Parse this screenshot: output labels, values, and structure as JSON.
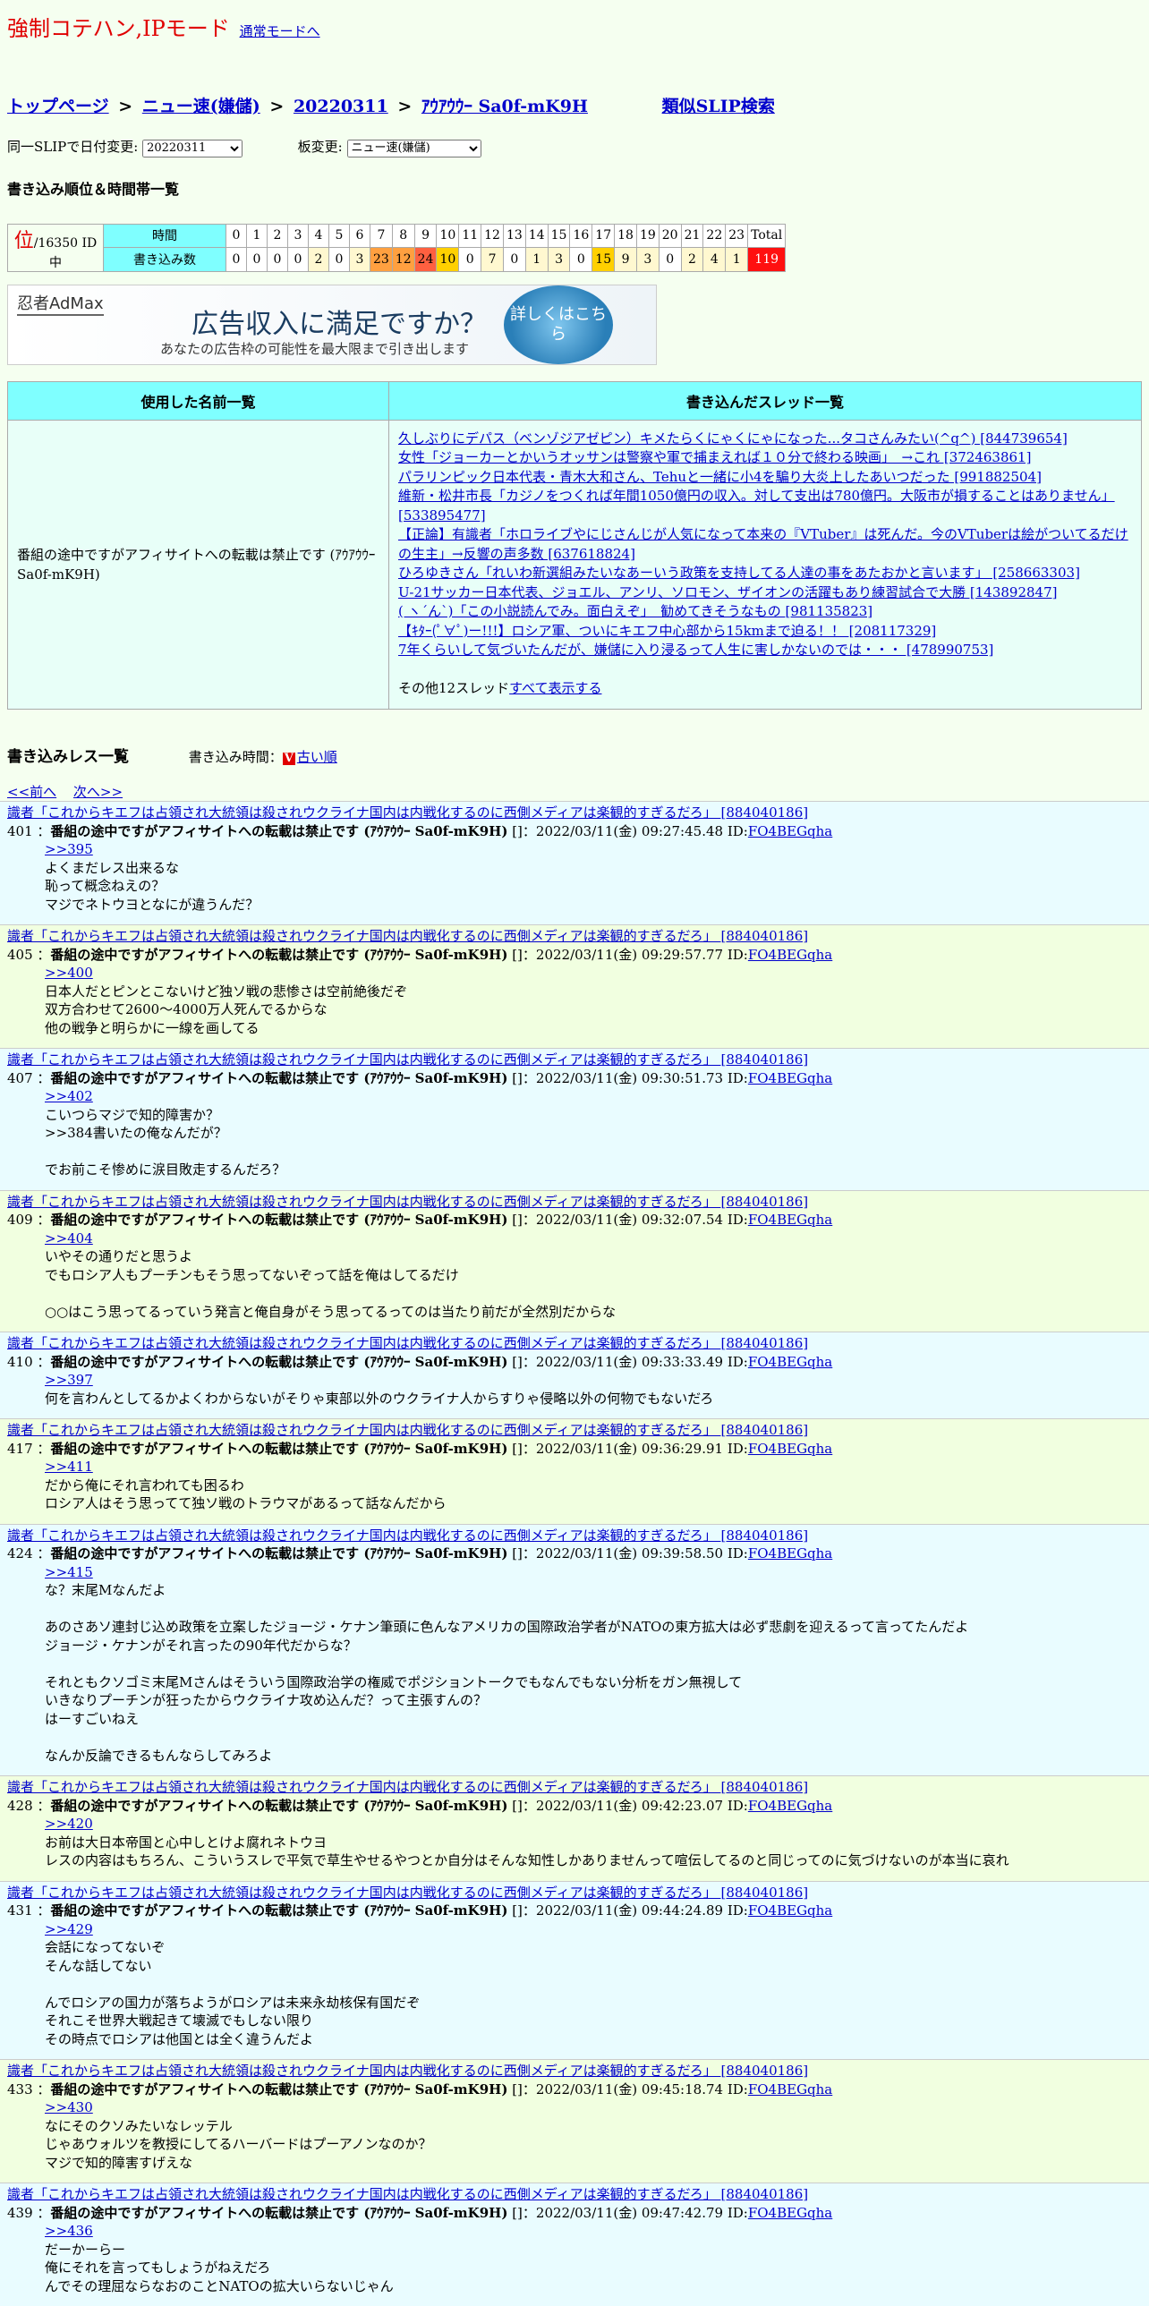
{
  "header": {
    "title": "強制コテハン,IPモード",
    "normal_mode_link": "通常モードへ"
  },
  "breadcrumb": {
    "top": "トップページ",
    "sep": ">",
    "board": "ニュー速(嫌儲)",
    "date": "20220311",
    "slip": "ｱｳｱｳｳｰ Sa0f-mK9H",
    "similar": "類似SLIP検索"
  },
  "selectors": {
    "date_label": "同一SLIPで日付変更:",
    "date_value": "20220311",
    "board_label": "板変更:",
    "board_value": "ニュー速(嫌儲)"
  },
  "ranking": {
    "heading": "書き込み順位＆時間帯一覧",
    "rank_kanji": "位",
    "rank_total": "/16350 ID中",
    "row1_label": "時間",
    "row2_label": "書き込み数",
    "hours": [
      "0",
      "1",
      "2",
      "3",
      "4",
      "5",
      "6",
      "7",
      "8",
      "9",
      "10",
      "11",
      "12",
      "13",
      "14",
      "15",
      "16",
      "17",
      "18",
      "19",
      "20",
      "21",
      "22",
      "23",
      "Total"
    ],
    "counts": [
      "0",
      "0",
      "0",
      "0",
      "2",
      "0",
      "3",
      "23",
      "12",
      "24",
      "10",
      "0",
      "7",
      "0",
      "1",
      "3",
      "0",
      "15",
      "9",
      "3",
      "0",
      "2",
      "4",
      "1",
      "119"
    ]
  },
  "ad": {
    "logo": "忍者AdMax",
    "headline": "広告収入に満足ですか？",
    "sub": "あなたの広告枠の可能性を最大限まで引き出します",
    "button": "詳しくはこちら"
  },
  "names_table": {
    "col1_header": "使用した名前一覧",
    "col2_header": "書き込んだスレッド一覧",
    "name": "番組の途中ですがアフィサイトへの転載は禁止です (ｱｳｱｳｳｰ Sa0f-mK9H)",
    "threads": [
      "久しぶりにデパス（ベンゾジアゼピン）キメたらくにゃくにゃになった...タコさんみたい(^q^) [844739654]",
      "女性「ジョーカーとかいうオッサンは警察や軍で捕まえれば１０分で終わる映画」　→これ [372463861]",
      "パラリンピック日本代表・青木大和さん、Tehuと一緒に小4を騙り大炎上したあいつだった [991882504]",
      "維新・松井市長「カジノをつくれば年間1050億円の収入。対して支出は780億円。大阪市が損することはありません」 [533895477]",
      "【正論】有識者「ホロライブやにじさんじが人気になって本来の『VTuber』は死んだ。今のVTuberは絵がついてるだけの生主」→反響の声多数 [637618824]",
      "ひろゆきさん「れいわ新選組みたいなあーいう政策を支持してる人達の事をあたおかと言います」 [258663303]",
      "U-21サッカー日本代表、ジョエル、アンリ、ソロモン、ザイオンの活躍もあり練習試合で大勝 [143892847]",
      "( ヽ´ん`)「この小説読んでみ。面白えぞ」　勧めてきそうなもの [981135823]",
      "【ｷﾀｰ(ﾟ∀ﾟ)ー!!!】ロシア軍、ついにキエフ中心部から15kmまで迫る！！ [208117329]",
      "7年くらいして気づいたんだが、嫌儲に入り浸るって人生に害しかないのでは・・・ [478990753]"
    ],
    "other_prefix": "その他12スレッド",
    "other_link": "すべて表示する"
  },
  "post_list": {
    "heading": "書き込みレス一覧",
    "time_label": "書き込み時間：",
    "order_icon": "V",
    "order_link": "古い順",
    "prev": "<<前へ",
    "next": "次へ>>"
  },
  "posts": [
    {
      "thread": "識者「これからキエフは占領され大統領は殺されウクライナ国内は内戦化するのに西側メディアは楽観的すぎるだろ」 [884040186]",
      "num": "401",
      "name": "番組の途中ですがアフィサイトへの転載は禁止です (ｱｳｱｳｳｰ Sa0f-mK9H)",
      "date": "[]：2022/03/11(金) 09:27:45.48 ID:",
      "id": "FO4BEGqha",
      "lines": [
        ">>395",
        "よくまだレス出来るな",
        "恥って概念ねえの？",
        "マジでネトウヨとなにが違うんだ？"
      ]
    },
    {
      "thread": "識者「これからキエフは占領され大統領は殺されウクライナ国内は内戦化するのに西側メディアは楽観的すぎるだろ」 [884040186]",
      "num": "405",
      "name": "番組の途中ですがアフィサイトへの転載は禁止です (ｱｳｱｳｳｰ Sa0f-mK9H)",
      "date": "[]：2022/03/11(金) 09:29:57.77 ID:",
      "id": "FO4BEGqha",
      "lines": [
        ">>400",
        "日本人だとピンとこないけど独ソ戦の悲惨さは空前絶後だぞ",
        "双方合わせて2600～4000万人死んでるからな",
        "他の戦争と明らかに一線を画してる"
      ]
    },
    {
      "thread": "識者「これからキエフは占領され大統領は殺されウクライナ国内は内戦化するのに西側メディアは楽観的すぎるだろ」 [884040186]",
      "num": "407",
      "name": "番組の途中ですがアフィサイトへの転載は禁止です (ｱｳｱｳｳｰ Sa0f-mK9H)",
      "date": "[]：2022/03/11(金) 09:30:51.73 ID:",
      "id": "FO4BEGqha",
      "lines": [
        ">>402",
        "こいつらマジで知的障害か？",
        ">>384書いたの俺なんだが？",
        "",
        "でお前こそ惨めに涙目敗走するんだろ？"
      ]
    },
    {
      "thread": "識者「これからキエフは占領され大統領は殺されウクライナ国内は内戦化するのに西側メディアは楽観的すぎるだろ」 [884040186]",
      "num": "409",
      "name": "番組の途中ですがアフィサイトへの転載は禁止です (ｱｳｱｳｳｰ Sa0f-mK9H)",
      "date": "[]：2022/03/11(金) 09:32:07.54 ID:",
      "id": "FO4BEGqha",
      "lines": [
        ">>404",
        "いやその通りだと思うよ",
        "でもロシア人もプーチンもそう思ってないぞって話を俺はしてるだけ",
        "",
        "○○はこう思ってるっていう発言と俺自身がそう思ってるってのは当たり前だが全然別だからな"
      ]
    },
    {
      "thread": "識者「これからキエフは占領され大統領は殺されウクライナ国内は内戦化するのに西側メディアは楽観的すぎるだろ」 [884040186]",
      "num": "410",
      "name": "番組の途中ですがアフィサイトへの転載は禁止です (ｱｳｱｳｳｰ Sa0f-mK9H)",
      "date": "[]：2022/03/11(金) 09:33:33.49 ID:",
      "id": "FO4BEGqha",
      "lines": [
        ">>397",
        "何を言わんとしてるかよくわからないがそりゃ東部以外のウクライナ人からすりゃ侵略以外の何物でもないだろ"
      ]
    },
    {
      "thread": "識者「これからキエフは占領され大統領は殺されウクライナ国内は内戦化するのに西側メディアは楽観的すぎるだろ」 [884040186]",
      "num": "417",
      "name": "番組の途中ですがアフィサイトへの転載は禁止です (ｱｳｱｳｳｰ Sa0f-mK9H)",
      "date": "[]：2022/03/11(金) 09:36:29.91 ID:",
      "id": "FO4BEGqha",
      "lines": [
        ">>411",
        "だから俺にそれ言われても困るわ",
        "ロシア人はそう思ってて独ソ戦のトラウマがあるって話なんだから"
      ]
    },
    {
      "thread": "識者「これからキエフは占領され大統領は殺されウクライナ国内は内戦化するのに西側メディアは楽観的すぎるだろ」 [884040186]",
      "num": "424",
      "name": "番組の途中ですがアフィサイトへの転載は禁止です (ｱｳｱｳｳｰ Sa0f-mK9H)",
      "date": "[]：2022/03/11(金) 09:39:58.50 ID:",
      "id": "FO4BEGqha",
      "lines": [
        ">>415",
        "な？末尾Mなんだよ",
        "",
        "あのさあソ連封じ込め政策を立案したジョージ・ケナン筆頭に色んなアメリカの国際政治学者がNATOの東方拡大は必ず悲劇を迎えるって言ってたんだよ",
        "ジョージ・ケナンがそれ言ったの90年代だからな？",
        "",
        "それともクソゴミ末尾Mさんはそういう国際政治学の権威でポジショントークでもなんでもない分析をガン無視して",
        "いきなりプーチンが狂ったからウクライナ攻め込んだ？って主張すんの？",
        "はーすごいねえ",
        "",
        "なんか反論できるもんならしてみろよ"
      ]
    },
    {
      "thread": "識者「これからキエフは占領され大統領は殺されウクライナ国内は内戦化するのに西側メディアは楽観的すぎるだろ」 [884040186]",
      "num": "428",
      "name": "番組の途中ですがアフィサイトへの転載は禁止です (ｱｳｱｳｳｰ Sa0f-mK9H)",
      "date": "[]：2022/03/11(金) 09:42:23.07 ID:",
      "id": "FO4BEGqha",
      "lines": [
        ">>420",
        "お前は大日本帝国と心中しとけよ腐れネトウヨ",
        "レスの内容はもちろん、こういうスレで平気で草生やせるやつとか自分はそんな知性しかありませんって喧伝してるのと同じってのに気づけないのが本当に哀れ"
      ]
    },
    {
      "thread": "識者「これからキエフは占領され大統領は殺されウクライナ国内は内戦化するのに西側メディアは楽観的すぎるだろ」 [884040186]",
      "num": "431",
      "name": "番組の途中ですがアフィサイトへの転載は禁止です (ｱｳｱｳｳｰ Sa0f-mK9H)",
      "date": "[]：2022/03/11(金) 09:44:24.89 ID:",
      "id": "FO4BEGqha",
      "lines": [
        ">>429",
        "会話になってないぞ",
        "そんな話してない",
        "",
        "んでロシアの国力が落ちようがロシアは未来永劫核保有国だぞ",
        "それこそ世界大戦起きて壊滅でもしない限り",
        "その時点でロシアは他国とは全く違うんだよ"
      ]
    },
    {
      "thread": "識者「これからキエフは占領され大統領は殺されウクライナ国内は内戦化するのに西側メディアは楽観的すぎるだろ」 [884040186]",
      "num": "433",
      "name": "番組の途中ですがアフィサイトへの転載は禁止です (ｱｳｱｳｳｰ Sa0f-mK9H)",
      "date": "[]：2022/03/11(金) 09:45:18.74 ID:",
      "id": "FO4BEGqha",
      "lines": [
        ">>430",
        "なにそのクソみたいなレッテル",
        "じゃあウォルツを教授にしてるハーバードはプーアノンなのか？",
        "マジで知的障害すげえな"
      ]
    },
    {
      "thread": "識者「これからキエフは占領され大統領は殺されウクライナ国内は内戦化するのに西側メディアは楽観的すぎるだろ」 [884040186]",
      "num": "439",
      "name": "番組の途中ですがアフィサイトへの転載は禁止です (ｱｳｱｳｳｰ Sa0f-mK9H)",
      "date": "[]：2022/03/11(金) 09:47:42.79 ID:",
      "id": "FO4BEGqha",
      "lines": [
        ">>436",
        "だーかーらー",
        "俺にそれを言ってもしょうがねえだろ",
        "んでその理屈ならなおのことNATOの拡大いらないじゃん"
      ]
    }
  ]
}
